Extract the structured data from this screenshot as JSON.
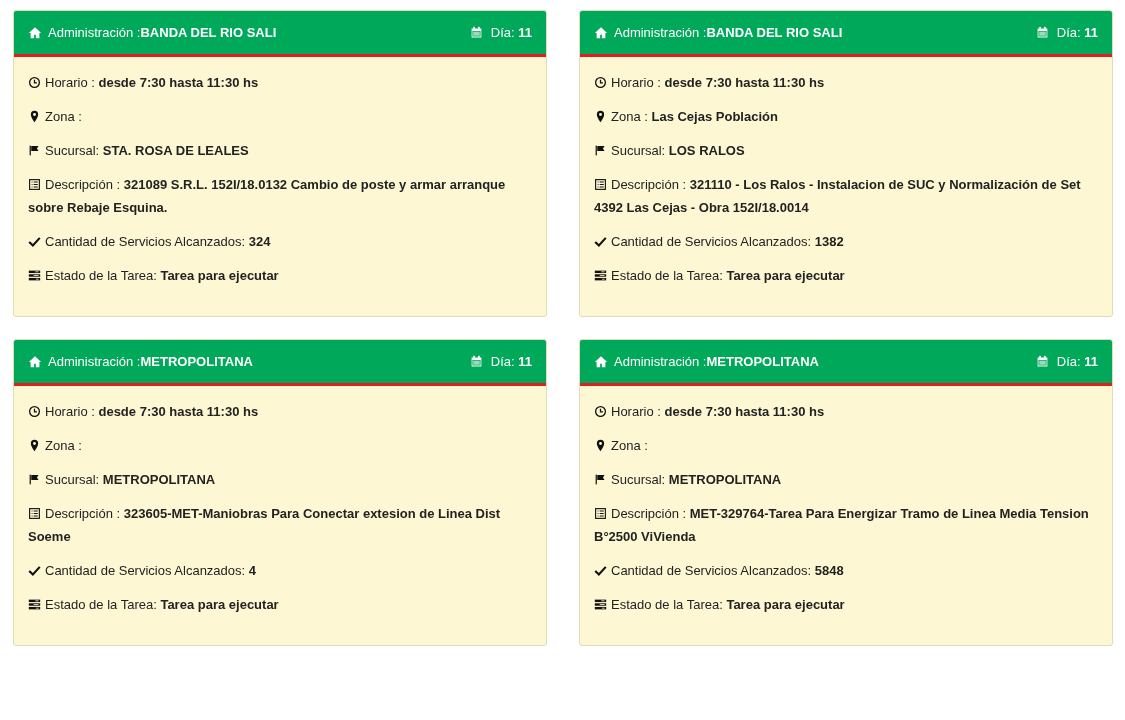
{
  "cards": [
    {
      "header": "Administración :**BANDA DEL RIO SALI**",
      "day": "Día: **11**",
      "fields": [
        {
          "kind": "clock",
          "text": "Horario : **desde 7:30 hasta 11:30 hs**"
        },
        {
          "kind": "pin",
          "text": "Zona :"
        },
        {
          "kind": "flag",
          "text": "Sucursal: **STA. ROSA DE LEALES**"
        },
        {
          "kind": "list",
          "text": "Descripción : **321089 S.R.L. 152I/18.0132 Cambio de poste y armar arranque sobre Rebaje Esquina.**"
        },
        {
          "kind": "check",
          "text": "Cantidad de Servicios Alcanzados: **324**"
        },
        {
          "kind": "tasks",
          "text": "Estado de la Tarea: **Tarea para ejecutar**"
        }
      ]
    },
    {
      "header": "Administración :**BANDA DEL RIO SALI**",
      "day": "Día: **11**",
      "fields": [
        {
          "kind": "clock",
          "text": "Horario : **desde 7:30 hasta 11:30 hs**"
        },
        {
          "kind": "pin",
          "text": "Zona : **Las Cejas Población**"
        },
        {
          "kind": "flag",
          "text": "Sucursal: **LOS RALOS**"
        },
        {
          "kind": "list",
          "text": "Descripción : **321110 - Los Ralos - Instalacion de SUC y Normalización de Set 4392 Las Cejas - Obra 152I/18.0014**"
        },
        {
          "kind": "check",
          "text": "Cantidad de Servicios Alcanzados: **1382**"
        },
        {
          "kind": "tasks",
          "text": "Estado de la Tarea: **Tarea para ejecutar**"
        }
      ]
    },
    {
      "header": "Administración :**METROPOLITANA**",
      "day": "Día: **11**",
      "fields": [
        {
          "kind": "clock",
          "text": "Horario : **desde 7:30 hasta 11:30 hs**"
        },
        {
          "kind": "pin",
          "text": "Zona :"
        },
        {
          "kind": "flag",
          "text": "Sucursal: **METROPOLITANA**"
        },
        {
          "kind": "list",
          "text": "Descripción : **323605-MET-Maniobras Para Conectar extesion de Linea Dist Soeme**"
        },
        {
          "kind": "check",
          "text": "Cantidad de Servicios Alcanzados: **4**"
        },
        {
          "kind": "tasks",
          "text": "Estado de la Tarea: **Tarea para ejecutar**"
        }
      ]
    },
    {
      "header": "Administración :**METROPOLITANA**",
      "day": "Día: **11**",
      "fields": [
        {
          "kind": "clock",
          "text": "Horario : **desde 7:30 hasta 11:30 hs**"
        },
        {
          "kind": "pin",
          "text": "Zona :"
        },
        {
          "kind": "flag",
          "text": "Sucursal: **METROPOLITANA**"
        },
        {
          "kind": "list",
          "text": "Descripción : **MET-329764-Tarea Para Energizar Tramo de Linea Media Tension B°2500 ViVienda**"
        },
        {
          "kind": "check",
          "text": "Cantidad de Servicios Alcanzados: **5848**"
        },
        {
          "kind": "tasks",
          "text": "Estado de la Tarea: **Tarea para ejecutar**"
        }
      ]
    }
  ]
}
